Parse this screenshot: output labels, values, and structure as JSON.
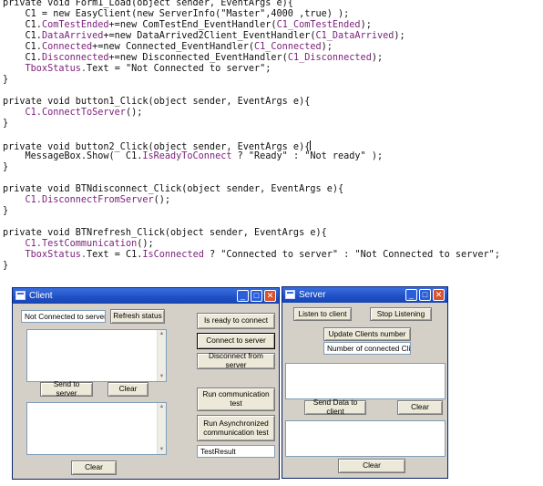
{
  "code": [
    [
      {
        "t": "private void Form1_Load(object sender, EventArgs e){",
        "c": "k"
      }
    ],
    [
      {
        "t": "    C1 = new EasyClient(new ServerInfo(\"Master\",4000 ,true) );",
        "c": "k"
      }
    ],
    [
      {
        "t": "    C1.",
        "c": "k"
      },
      {
        "t": "ComTestEnded",
        "c": "p"
      },
      {
        "t": "+=new ComTestEnd_EventHandler(",
        "c": "k"
      },
      {
        "t": "C1_ComTestEnded",
        "c": "p"
      },
      {
        "t": ");",
        "c": "k"
      }
    ],
    [
      {
        "t": "    C1.",
        "c": "k"
      },
      {
        "t": "DataArrived",
        "c": "p"
      },
      {
        "t": "+=new DataArrived2Client_EventHandler(",
        "c": "k"
      },
      {
        "t": "C1_DataArrived",
        "c": "p"
      },
      {
        "t": ");",
        "c": "k"
      }
    ],
    [
      {
        "t": "    C1.",
        "c": "k"
      },
      {
        "t": "Connected",
        "c": "p"
      },
      {
        "t": "+=new Connected_EventHandler(",
        "c": "k"
      },
      {
        "t": "C1_Connected",
        "c": "p"
      },
      {
        "t": ");",
        "c": "k"
      }
    ],
    [
      {
        "t": "    C1.",
        "c": "k"
      },
      {
        "t": "Disconnected",
        "c": "p"
      },
      {
        "t": "+=new Disconnected_EventHandler(",
        "c": "k"
      },
      {
        "t": "C1_Disconnected",
        "c": "p"
      },
      {
        "t": ");",
        "c": "k"
      }
    ],
    [
      {
        "t": "    TboxStatus.",
        "c": "p"
      },
      {
        "t": "Text",
        "c": "k"
      },
      {
        "t": " = \"Not Connected to server\";",
        "c": "k"
      }
    ],
    [
      {
        "t": "}",
        "c": "k"
      }
    ],
    [],
    [
      {
        "t": "private void button1_Click(object sender, EventArgs e){",
        "c": "k"
      }
    ],
    [
      {
        "t": "    C1.",
        "c": "p"
      },
      {
        "t": "ConnectToServer",
        "c": "p"
      },
      {
        "t": "();",
        "c": "k"
      }
    ],
    [
      {
        "t": "}",
        "c": "k"
      }
    ],
    [],
    [
      {
        "t": "private void button2_Click(object sender, EventArgs e){",
        "c": "k",
        "caret": true
      }
    ],
    [
      {
        "t": "    MessageBox.Show(  C1.",
        "c": "k"
      },
      {
        "t": "IsReadyToConnect",
        "c": "p"
      },
      {
        "t": " ? \"Ready\" : \"Not ready\" );",
        "c": "k"
      }
    ],
    [
      {
        "t": "}",
        "c": "k"
      }
    ],
    [],
    [
      {
        "t": "private void BTNdisconnect_Click(object sender, EventArgs e){",
        "c": "k"
      }
    ],
    [
      {
        "t": "    C1.",
        "c": "p"
      },
      {
        "t": "DisconnectFromServer",
        "c": "p"
      },
      {
        "t": "();",
        "c": "k"
      }
    ],
    [
      {
        "t": "}",
        "c": "k"
      }
    ],
    [],
    [
      {
        "t": "private void BTNrefresh_Click(object sender, EventArgs e){",
        "c": "k"
      }
    ],
    [
      {
        "t": "    C1.",
        "c": "p"
      },
      {
        "t": "TestCommunication",
        "c": "p"
      },
      {
        "t": "();",
        "c": "k"
      }
    ],
    [
      {
        "t": "    TboxStatus.",
        "c": "p"
      },
      {
        "t": "Text",
        "c": "k"
      },
      {
        "t": " = C1.",
        "c": "k"
      },
      {
        "t": "IsConnected",
        "c": "p"
      },
      {
        "t": " ? \"Connected to server\" : \"Not Connected to server\";",
        "c": "k"
      }
    ],
    [
      {
        "t": "}",
        "c": "k"
      }
    ]
  ],
  "client": {
    "title": "Client",
    "status_text": "Not Connected to server",
    "refresh_label": "Refresh status",
    "send_label": "Send to server",
    "clear_top_label": "Clear",
    "clear_bottom_label": "Clear",
    "ready_label": "Is ready to connect",
    "connect_label": "Connect to server",
    "disconnect_label": "Disconnect from server",
    "run_test_label": "Run communication test",
    "run_async_label": "Run Asynchronized communication test",
    "test_result": "TestResult"
  },
  "server": {
    "title": "Server",
    "listen_label": "Listen to client",
    "stop_label": "Stop Listening",
    "update_label": "Update Clients number",
    "clients_count_text": "Number of connected Clients",
    "send_data_label": "Send Data to client",
    "clear_top_label": "Clear",
    "clear_bottom_label": "Clear"
  },
  "colors": {
    "titlebar": "#1f4fc4",
    "window_bg": "#d4d0c8",
    "code_member": "#7a1e7a"
  }
}
